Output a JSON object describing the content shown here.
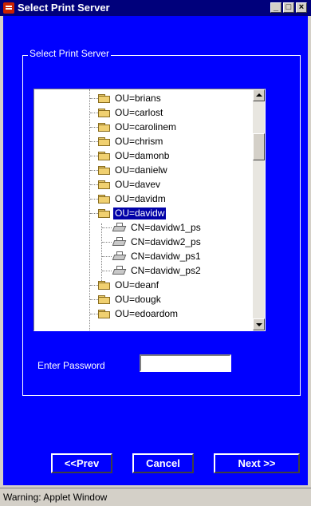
{
  "window": {
    "title": "Select Print Server"
  },
  "group": {
    "title": "Select Print Server"
  },
  "tree": {
    "items": [
      {
        "label": "OU=brians",
        "type": "ou"
      },
      {
        "label": "OU=carlost",
        "type": "ou"
      },
      {
        "label": "OU=carolinem",
        "type": "ou"
      },
      {
        "label": "OU=chrism",
        "type": "ou"
      },
      {
        "label": "OU=damonb",
        "type": "ou"
      },
      {
        "label": "OU=danielw",
        "type": "ou"
      },
      {
        "label": "OU=davev",
        "type": "ou"
      },
      {
        "label": "OU=davidm",
        "type": "ou"
      },
      {
        "label": "OU=davidw",
        "type": "ou",
        "selected": true,
        "expanded": true
      },
      {
        "label": "CN=davidw1_ps",
        "type": "cn"
      },
      {
        "label": "CN=davidw2_ps",
        "type": "cn"
      },
      {
        "label": "CN=davidw_ps1",
        "type": "cn"
      },
      {
        "label": "CN=davidw_ps2",
        "type": "cn"
      },
      {
        "label": "OU=deanf",
        "type": "ou"
      },
      {
        "label": "OU=dougk",
        "type": "ou"
      },
      {
        "label": "OU=edoardom",
        "type": "ou"
      }
    ]
  },
  "password": {
    "label": "Enter Password",
    "value": ""
  },
  "buttons": {
    "prev": "<<Prev",
    "cancel": "Cancel",
    "next": "Next >>"
  },
  "status": {
    "text": "Warning: Applet Window"
  },
  "colors": {
    "background": "#0000ff",
    "titlebar": "#00007b",
    "selection": "#0000a8"
  }
}
